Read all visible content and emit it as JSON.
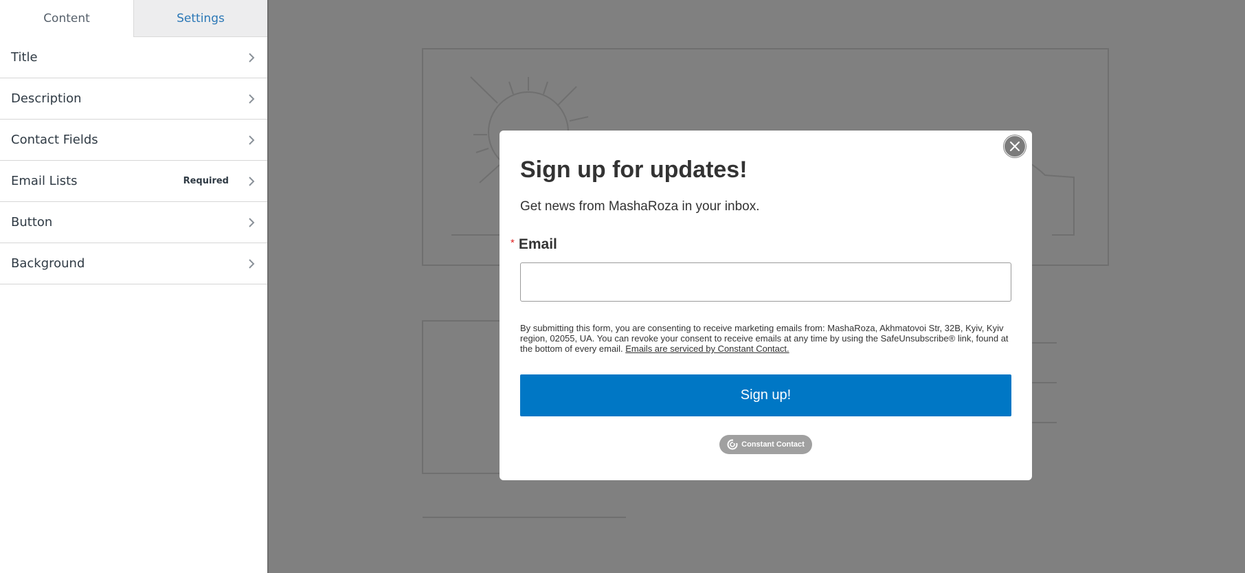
{
  "sidebar": {
    "tabs": [
      {
        "label": "Content",
        "active": true
      },
      {
        "label": "Settings",
        "active": false
      }
    ],
    "items": [
      {
        "label": "Title",
        "badge": ""
      },
      {
        "label": "Description",
        "badge": ""
      },
      {
        "label": "Contact Fields",
        "badge": ""
      },
      {
        "label": "Email Lists",
        "badge": "Required"
      },
      {
        "label": "Button",
        "badge": ""
      },
      {
        "label": "Background",
        "badge": ""
      }
    ]
  },
  "modal": {
    "title": "Sign up for updates!",
    "description": "Get news from MashaRoza in your inbox.",
    "email_label": "Email",
    "required_marker": "*",
    "email_value": "",
    "consent_text": "By submitting this form, you are consenting to receive marketing emails from: MashaRoza, Akhmatovoi Str, 32B, Kyiv, Kyiv region, 02055, UA. You can revoke your consent to receive emails at any time by using the SafeUnsubscribe® link, found at the bottom of every email. ",
    "consent_link": "Emails are serviced by Constant Contact.",
    "button_label": "Sign up!",
    "badge_label": "Constant Contact"
  },
  "colors": {
    "overlay": "#808080",
    "button": "#0077c5",
    "tab_link": "#2a77b6",
    "required": "#e02424"
  },
  "icons": {
    "close": "close-icon",
    "chevron": "chevron-right-icon",
    "cc_logo": "constant-contact-logo-icon"
  }
}
